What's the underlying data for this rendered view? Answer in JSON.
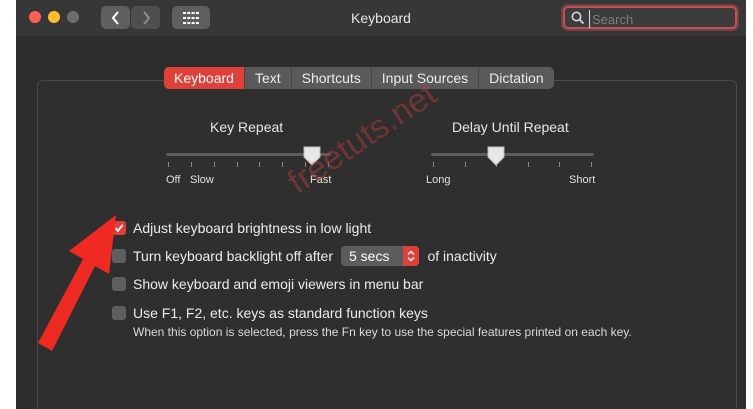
{
  "window": {
    "title": "Keyboard"
  },
  "search": {
    "placeholder": "Search",
    "value": ""
  },
  "tabs": [
    {
      "label": "Keyboard",
      "active": true
    },
    {
      "label": "Text",
      "active": false
    },
    {
      "label": "Shortcuts",
      "active": false
    },
    {
      "label": "Input Sources",
      "active": false
    },
    {
      "label": "Dictation",
      "active": false
    }
  ],
  "key_repeat": {
    "label": "Key Repeat",
    "min_label": "Off",
    "slow_label": "Slow",
    "max_label": "Fast",
    "level": 0.9
  },
  "delay_until_repeat": {
    "label": "Delay Until Repeat",
    "min_label": "Long",
    "max_label": "Short",
    "level": 0.4
  },
  "options": {
    "brightness": {
      "label": "Adjust keyboard brightness in low light",
      "checked": true
    },
    "backlight": {
      "prefix": "Turn keyboard backlight off after",
      "value": "5 secs",
      "suffix": "of inactivity",
      "checked": false
    },
    "emoji": {
      "label": "Show keyboard and emoji viewers in menu bar",
      "checked": false
    },
    "fn_keys": {
      "label": "Use F1, F2, etc. keys as standard function keys",
      "checked": false,
      "note": "When this option is selected, press the Fn key to use the special features printed on each key."
    }
  },
  "watermark": "freetuts.net",
  "colors": {
    "accent": "#e0403a",
    "window_bg": "#2d2d2d",
    "arrow": "#ee2a22"
  },
  "icons": [
    "back-chevron-icon",
    "forward-chevron-icon",
    "grid-icon",
    "search-icon",
    "checkmark-icon",
    "stepper-arrows-icon",
    "red-arrow-annotation"
  ]
}
